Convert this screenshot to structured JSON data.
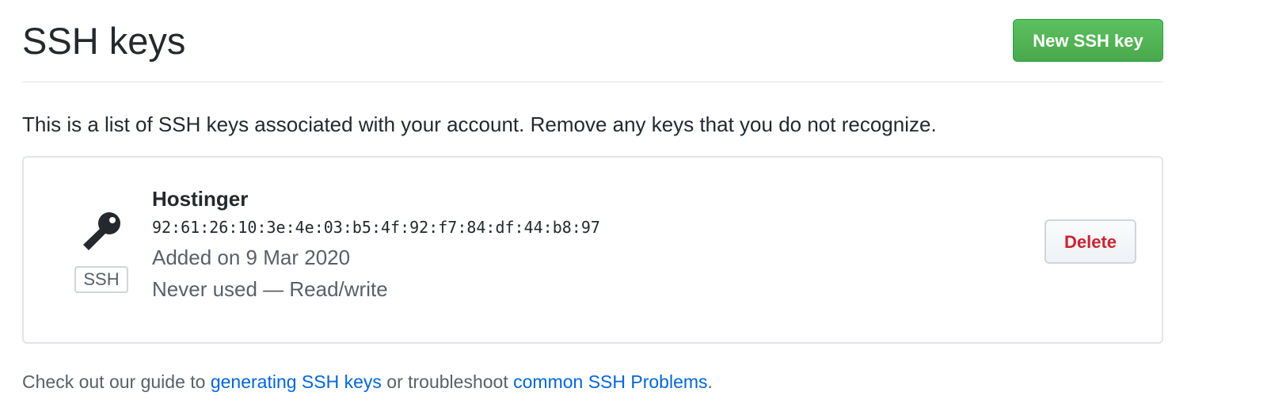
{
  "header": {
    "title": "SSH keys",
    "new_key_label": "New SSH key"
  },
  "description": "This is a list of SSH keys associated with your account. Remove any keys that you do not recognize.",
  "keys": [
    {
      "icon": "key-icon",
      "type_badge": "SSH",
      "title": "Hostinger",
      "fingerprint": "92:61:26:10:3e:4e:03:b5:4f:92:f7:84:df:44:b8:97",
      "added": "Added on 9 Mar 2020",
      "usage": "Never used — Read/write",
      "delete_label": "Delete"
    }
  ],
  "footer": {
    "prefix": "Check out our guide to ",
    "link1": "generating SSH keys",
    "middle": " or troubleshoot ",
    "link2": "common SSH Problems",
    "suffix": "."
  },
  "colors": {
    "primary_button": "#4aa84c",
    "danger_text": "#cb2431",
    "link": "#0366d6",
    "muted_text": "#586069"
  }
}
